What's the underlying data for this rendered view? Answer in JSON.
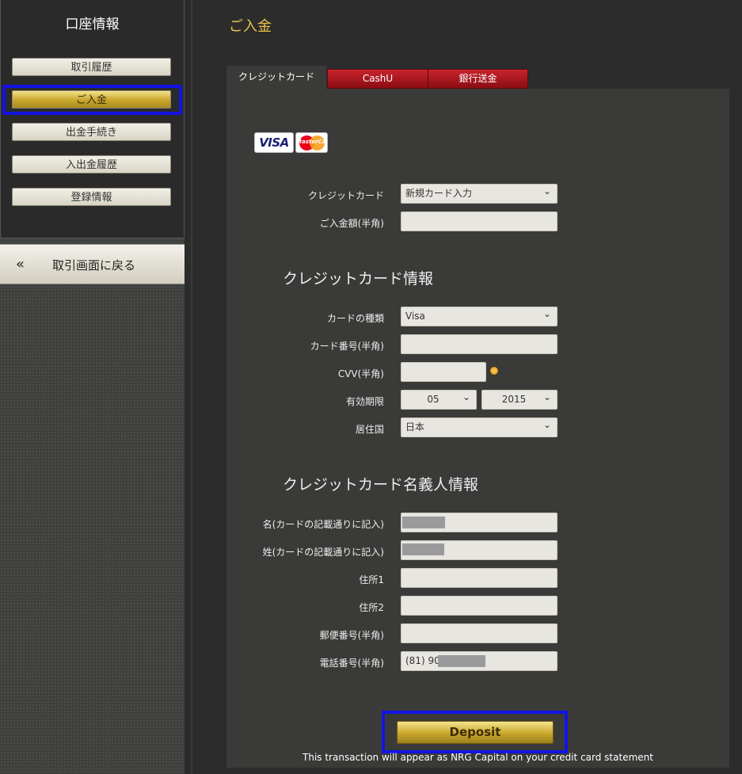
{
  "sidebar": {
    "title": "口座情報",
    "items": [
      {
        "label": "取引履歴"
      },
      {
        "label": "ご入金"
      },
      {
        "label": "出金手続き"
      },
      {
        "label": "入出金履歴"
      },
      {
        "label": "登録情報"
      }
    ],
    "back": {
      "icon": "«",
      "label": "取引画面に戻る"
    }
  },
  "page": {
    "title": "ご入金"
  },
  "tabs": [
    {
      "label": "クレジットカード"
    },
    {
      "label": "CashU"
    },
    {
      "label": "銀行送金"
    }
  ],
  "logos": {
    "visa": "VISA",
    "mastercard": "MasterCard"
  },
  "form": {
    "credit_card_label": "クレジットカード",
    "credit_card_value": "新規カード入力",
    "amount_label": "ご入金額(半角)",
    "amount_value": "",
    "card_info_title": "クレジットカード情報",
    "card_type_label": "カードの種類",
    "card_type_value": "Visa",
    "card_number_label": "カード番号(半角)",
    "card_number_value": "",
    "cvv_label": "CVV(半角)",
    "cvv_value": "",
    "expiry_label": "有効期限",
    "expiry_month": "05",
    "expiry_year": "2015",
    "country_label": "居住国",
    "country_value": "日本",
    "holder_title": "クレジットカード名義人情報",
    "first_name_label": "名(カードの記載通りに記入)",
    "last_name_label": "姓(カードの記載通りに記入)",
    "address1_label": "住所1",
    "address2_label": "住所2",
    "postal_label": "郵便番号(半角)",
    "phone_label": "電話番号(半角)",
    "phone_value": "(81) 90-"
  },
  "deposit": {
    "button_label": "Deposit",
    "note": "This transaction will appear as NRG Capital on your credit card statement"
  },
  "colors": {
    "accent": "#e7c34b",
    "highlight_box": "#1313e6",
    "tab_red": "#b51c23"
  }
}
